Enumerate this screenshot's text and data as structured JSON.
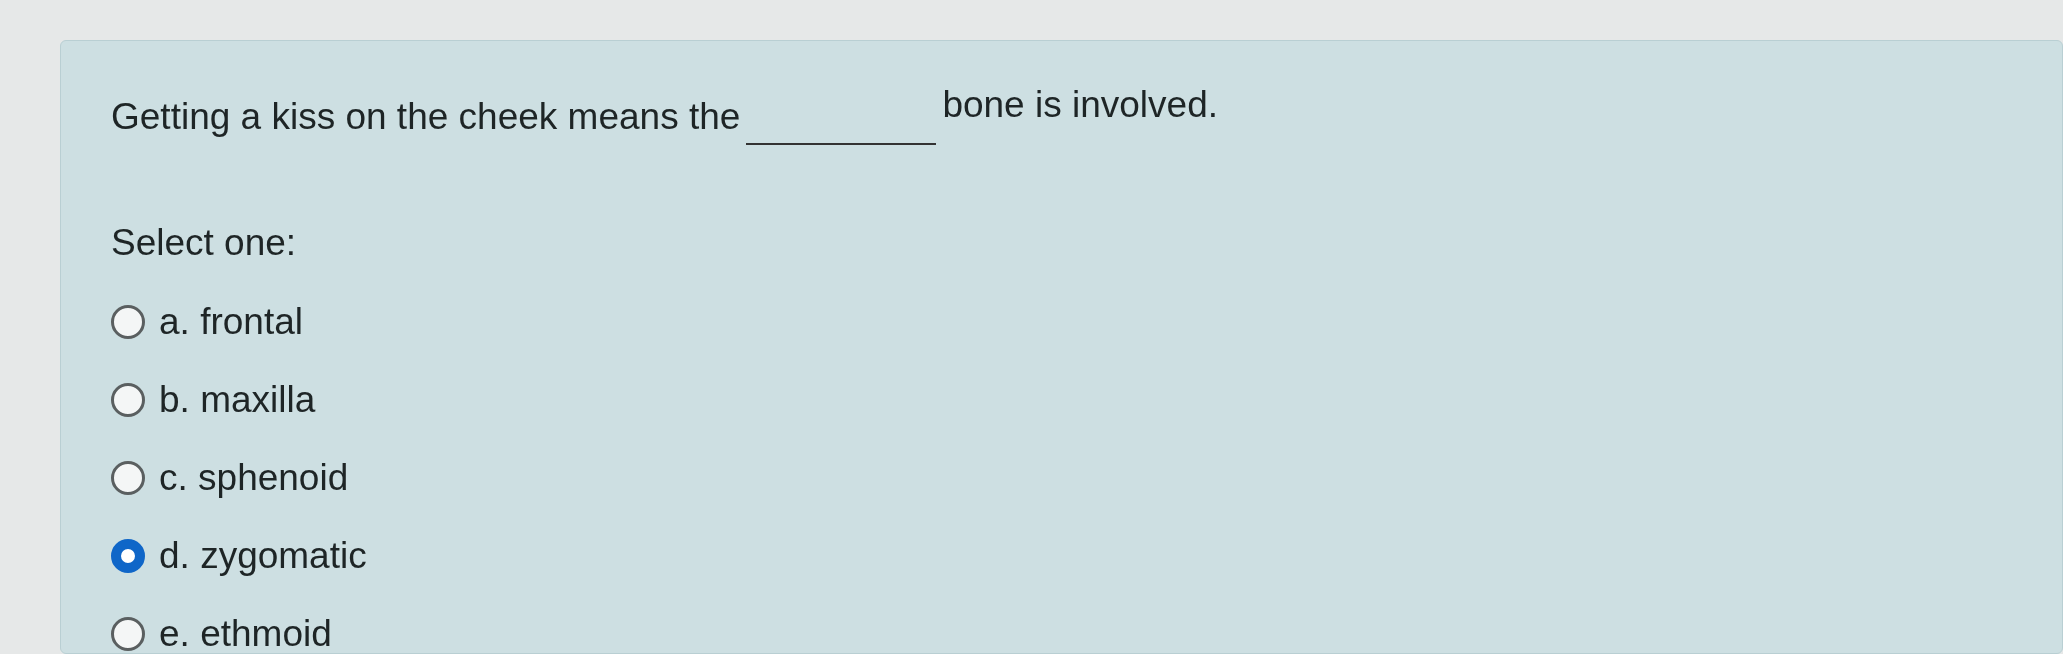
{
  "question": {
    "before": "Getting a kiss on the cheek means the",
    "after": "bone is involved."
  },
  "prompt": "Select one:",
  "options": [
    {
      "label": "a. frontal",
      "selected": false
    },
    {
      "label": "b. maxilla",
      "selected": false
    },
    {
      "label": "c. sphenoid",
      "selected": false
    },
    {
      "label": "d. zygomatic",
      "selected": true
    },
    {
      "label": "e. ethmoid",
      "selected": false
    }
  ]
}
